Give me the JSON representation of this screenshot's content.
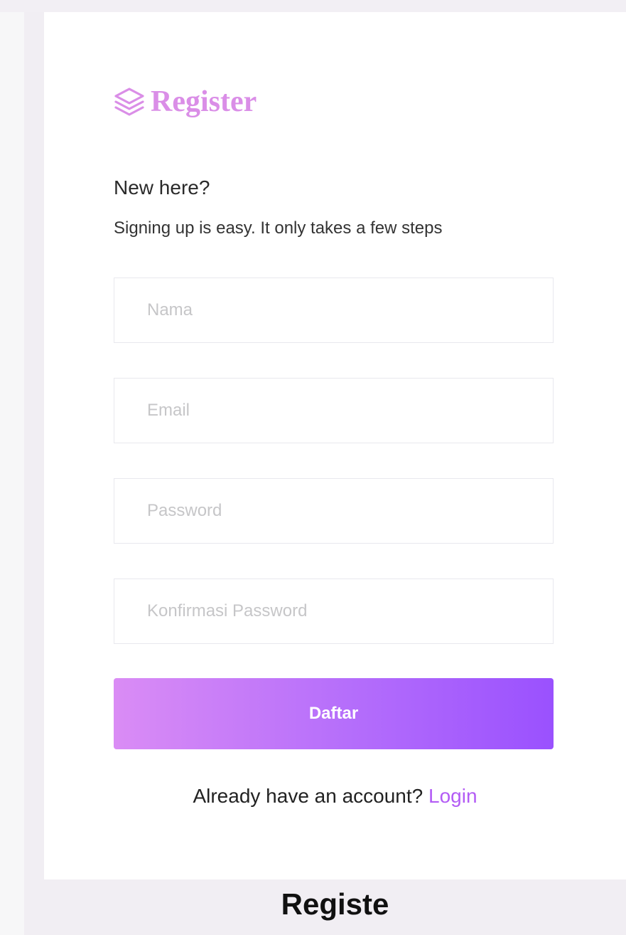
{
  "brand": {
    "icon": "layers-icon",
    "title": "Register",
    "color": "#da8ee7"
  },
  "intro": {
    "heading": "New here?",
    "subheading": "Signing up is easy. It only takes a few steps"
  },
  "form": {
    "name_placeholder": "Nama",
    "email_placeholder": "Email",
    "password_placeholder": "Password",
    "confirm_password_placeholder": "Konfirmasi Password",
    "submit_label": "Daftar"
  },
  "footer": {
    "prompt": "Already have an account?",
    "login_label": "Login"
  },
  "caption": "Registe",
  "colors": {
    "accent": "#b35cf5",
    "button_gradient_start": "#da8cf5",
    "button_gradient_end": "#9a51fe",
    "background": "#f1eef3"
  }
}
